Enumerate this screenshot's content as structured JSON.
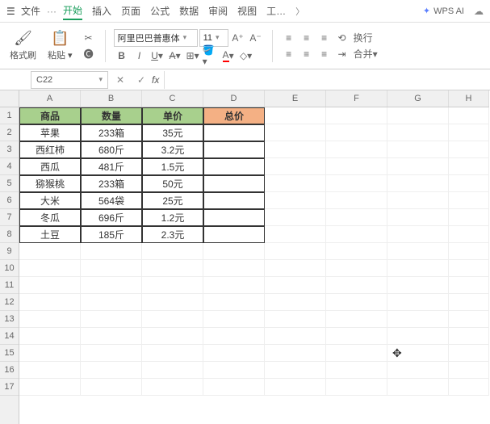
{
  "titlebar": {
    "file_label": "文件",
    "dots": "···"
  },
  "tabs": {
    "items": [
      "开始",
      "插入",
      "页面",
      "公式",
      "数据",
      "审阅",
      "视图",
      "工…"
    ],
    "active_index": 0,
    "overflow_arrow": "〉"
  },
  "wps_ai": {
    "label": "WPS AI",
    "icon": "✦"
  },
  "ribbon": {
    "format_painter": "格式刷",
    "paste": "粘贴",
    "font_name": "阿里巴巴普惠体",
    "font_size": "11"
  },
  "align_labels": {
    "wrap": "换行",
    "merge": "合并"
  },
  "namebox": {
    "value": "C22",
    "cancel": "✕",
    "confirm": "✓",
    "fx": "fx"
  },
  "columns": [
    "A",
    "B",
    "C",
    "D",
    "E",
    "F",
    "G",
    "H"
  ],
  "row_count": 17,
  "headers": {
    "a": "商品",
    "b": "数量",
    "c": "单价",
    "d": "总价"
  },
  "data": [
    {
      "a": "苹果",
      "b": "233箱",
      "c": "35元"
    },
    {
      "a": "西红柿",
      "b": "680斤",
      "c": "3.2元"
    },
    {
      "a": "西瓜",
      "b": "481斤",
      "c": "1.5元"
    },
    {
      "a": "猕猴桃",
      "b": "233箱",
      "c": "50元"
    },
    {
      "a": "大米",
      "b": "564袋",
      "c": "25元"
    },
    {
      "a": "冬瓜",
      "b": "696斤",
      "c": "1.2元"
    },
    {
      "a": "土豆",
      "b": "185斤",
      "c": "2.3元"
    }
  ]
}
